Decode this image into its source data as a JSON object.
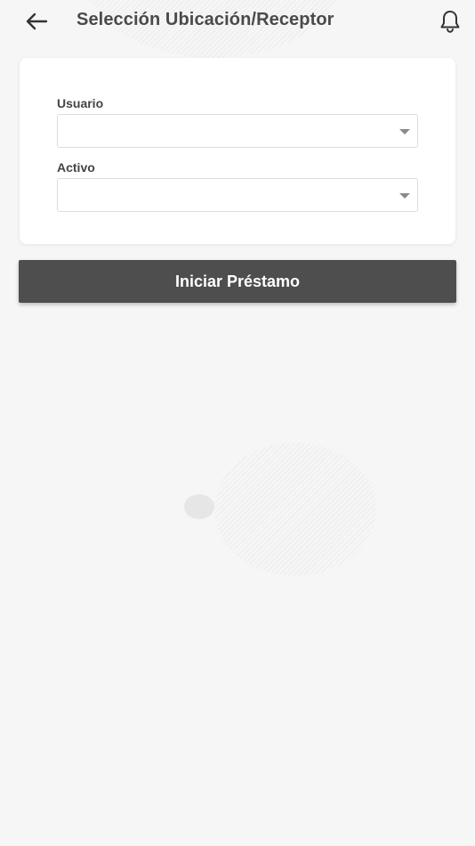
{
  "header": {
    "title": "Selección Ubicación/Receptor",
    "back_icon": "arrow-left-icon",
    "notifications_icon": "bell-icon"
  },
  "form": {
    "usuario": {
      "label": "Usuario",
      "value": ""
    },
    "activo": {
      "label": "Activo",
      "value": ""
    }
  },
  "actions": {
    "start_loan_label": "Iniciar Préstamo"
  },
  "colors": {
    "background": "#f6f6f6",
    "card": "#ffffff",
    "button": "#4e4e4e",
    "title_text": "#4a4a4a"
  }
}
